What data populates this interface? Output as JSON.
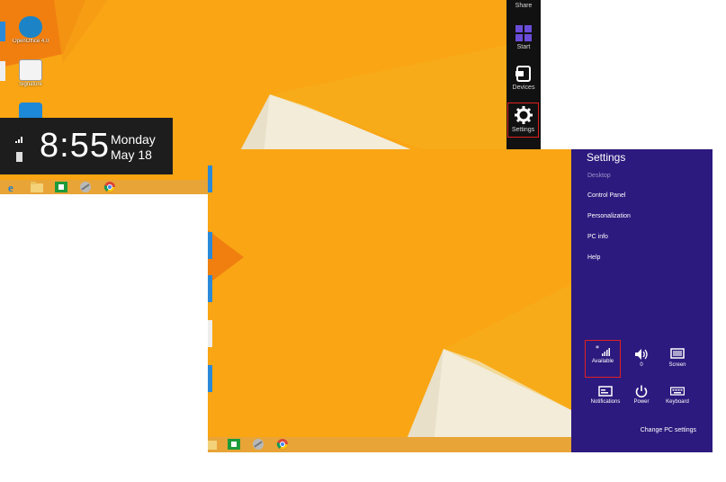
{
  "clock": {
    "time": "8:55",
    "day": "Monday",
    "date": "May 18"
  },
  "desktop_icons": [
    {
      "label": "OpenOffice 4.0.0"
    },
    {
      "label": "Signature"
    }
  ],
  "charms": [
    {
      "label": "Share"
    },
    {
      "label": "Start"
    },
    {
      "label": "Devices"
    },
    {
      "label": "Settings"
    }
  ],
  "settings_pane": {
    "title": "Settings",
    "links": [
      {
        "label": "Desktop",
        "dim": true
      },
      {
        "label": "Control Panel"
      },
      {
        "label": "Personalization"
      },
      {
        "label": "PC info"
      },
      {
        "label": "Help"
      }
    ],
    "quick_settings": [
      {
        "label": "Available",
        "icon": "wifi-available-icon"
      },
      {
        "label": "0",
        "icon": "volume-icon"
      },
      {
        "label": "Screen",
        "icon": "screen-icon"
      },
      {
        "label": "Notifications",
        "icon": "notifications-icon"
      },
      {
        "label": "Power",
        "icon": "power-icon"
      },
      {
        "label": "Keyboard",
        "icon": "keyboard-icon"
      }
    ],
    "change_pc_settings": "Change PC settings"
  },
  "colors": {
    "wallpaper": "#f9a514",
    "settings_pane": "#2c1a7e",
    "charm_bar": "#111111",
    "highlight": "#e02020"
  }
}
